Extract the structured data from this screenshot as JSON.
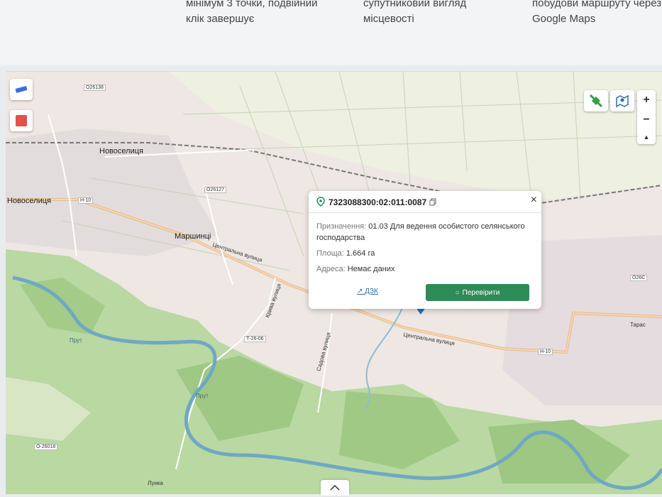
{
  "info_strip": {
    "col1": "",
    "col2": "мінімум 3 точки, подвійний\nклік завершує",
    "col3": "супутниковий вигляд\nмісцевості",
    "col4": "побудови маршруту через\nGoogle Maps"
  },
  "map": {
    "labels": {
      "novoselytsia_top": "Новоселиця",
      "novoselytsia_left": "Новоселиця",
      "marshyntsi": "Маршинці",
      "lunka": "Лунка",
      "taras": "Тарас",
      "prut_1": "Прут",
      "prut_2": "Прут",
      "central_st_1": "Центральна вулиця",
      "central_st_2": "Центральна вулиця",
      "kryva_st": "Крива вулиця",
      "sadova_st": "Садова вулиця",
      "road_o26138": "О26138",
      "road_o26127": "О26127",
      "road_h10_left": "Н-10",
      "road_h10_right": "Н-10",
      "road_t2606": "Т-26-06",
      "road_o26018": "О-26018",
      "road_o26c": "О26С"
    },
    "zoom_in": "+",
    "zoom_out": "−",
    "compass": "▲"
  },
  "popup": {
    "cadastral_number": "7323088300:02:011:0087",
    "close": "×",
    "purpose_label": "Призначення:",
    "purpose_value": "01.03 Для ведення особистого селянського",
    "purpose_value_2": "господарства",
    "area_label": "Площа:",
    "area_value": "1.664 га",
    "address_label": "Адреса:",
    "address_value": "Немає даних",
    "dzk_link": "ДЗК",
    "check_button": "Перевірити"
  },
  "colors": {
    "accent_green": "#2e8b57",
    "river": "#6fa8c4",
    "forest": "#a9cf8e",
    "link_blue": "#2a6fb0"
  }
}
